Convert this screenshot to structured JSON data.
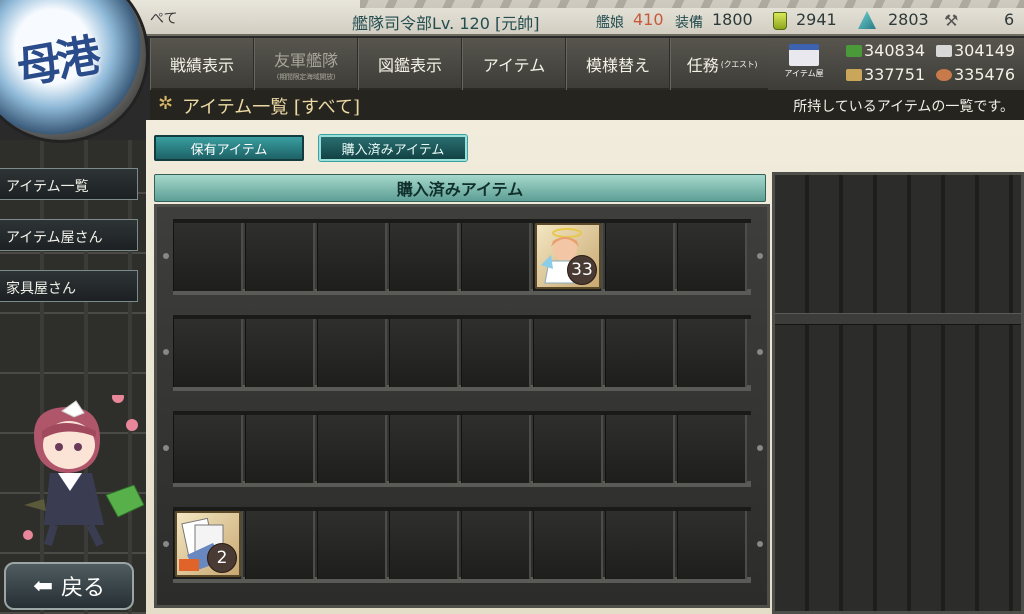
{
  "port_badge": "母港",
  "topbar": {
    "player_name": "ぺて",
    "hq_prefix": "艦隊司令部",
    "hq_level": "Lv. 120",
    "rank": "[元帥]",
    "ships_label": "艦娘",
    "ships_count": "410",
    "equip_label": "装備",
    "equip_count": "1800",
    "bucket_count": "2941",
    "dev_count": "2803",
    "screw_count": "6"
  },
  "nav": [
    {
      "label": "戦績表示",
      "sub": ""
    },
    {
      "label": "友軍艦隊",
      "sub": "(期間限定海域開放)"
    },
    {
      "label": "図鑑表示",
      "sub": ""
    },
    {
      "label": "アイテム",
      "sub": ""
    },
    {
      "label": "模様替え",
      "sub": ""
    },
    {
      "label": "任務",
      "sub": "(クエスト)"
    }
  ],
  "shop_icon_label": "アイテム屋",
  "resources": {
    "fuel": "340834",
    "steel": "304149",
    "ammo": "337751",
    "bauxite": "335476"
  },
  "colors": {
    "accent": "#3a9ea0",
    "header_text": "#ecd9a4"
  },
  "header": {
    "title": "アイテム一覧 [すべて]",
    "description": "所持しているアイテムの一覧です。"
  },
  "sidebar": {
    "items": [
      {
        "label": "アイテム一覧"
      },
      {
        "label": "アイテム屋さん"
      },
      {
        "label": "家具屋さん"
      }
    ],
    "back_label": "戻る"
  },
  "tabs": {
    "owned": "保有アイテム",
    "purchased": "購入済みアイテム"
  },
  "section_title": "購入済みアイテム",
  "items": [
    {
      "row": 0,
      "col": 5,
      "count": "33",
      "icon": "fairy-item-icon"
    },
    {
      "row": 3,
      "col": 0,
      "count": "2",
      "icon": "document-item-icon"
    }
  ]
}
